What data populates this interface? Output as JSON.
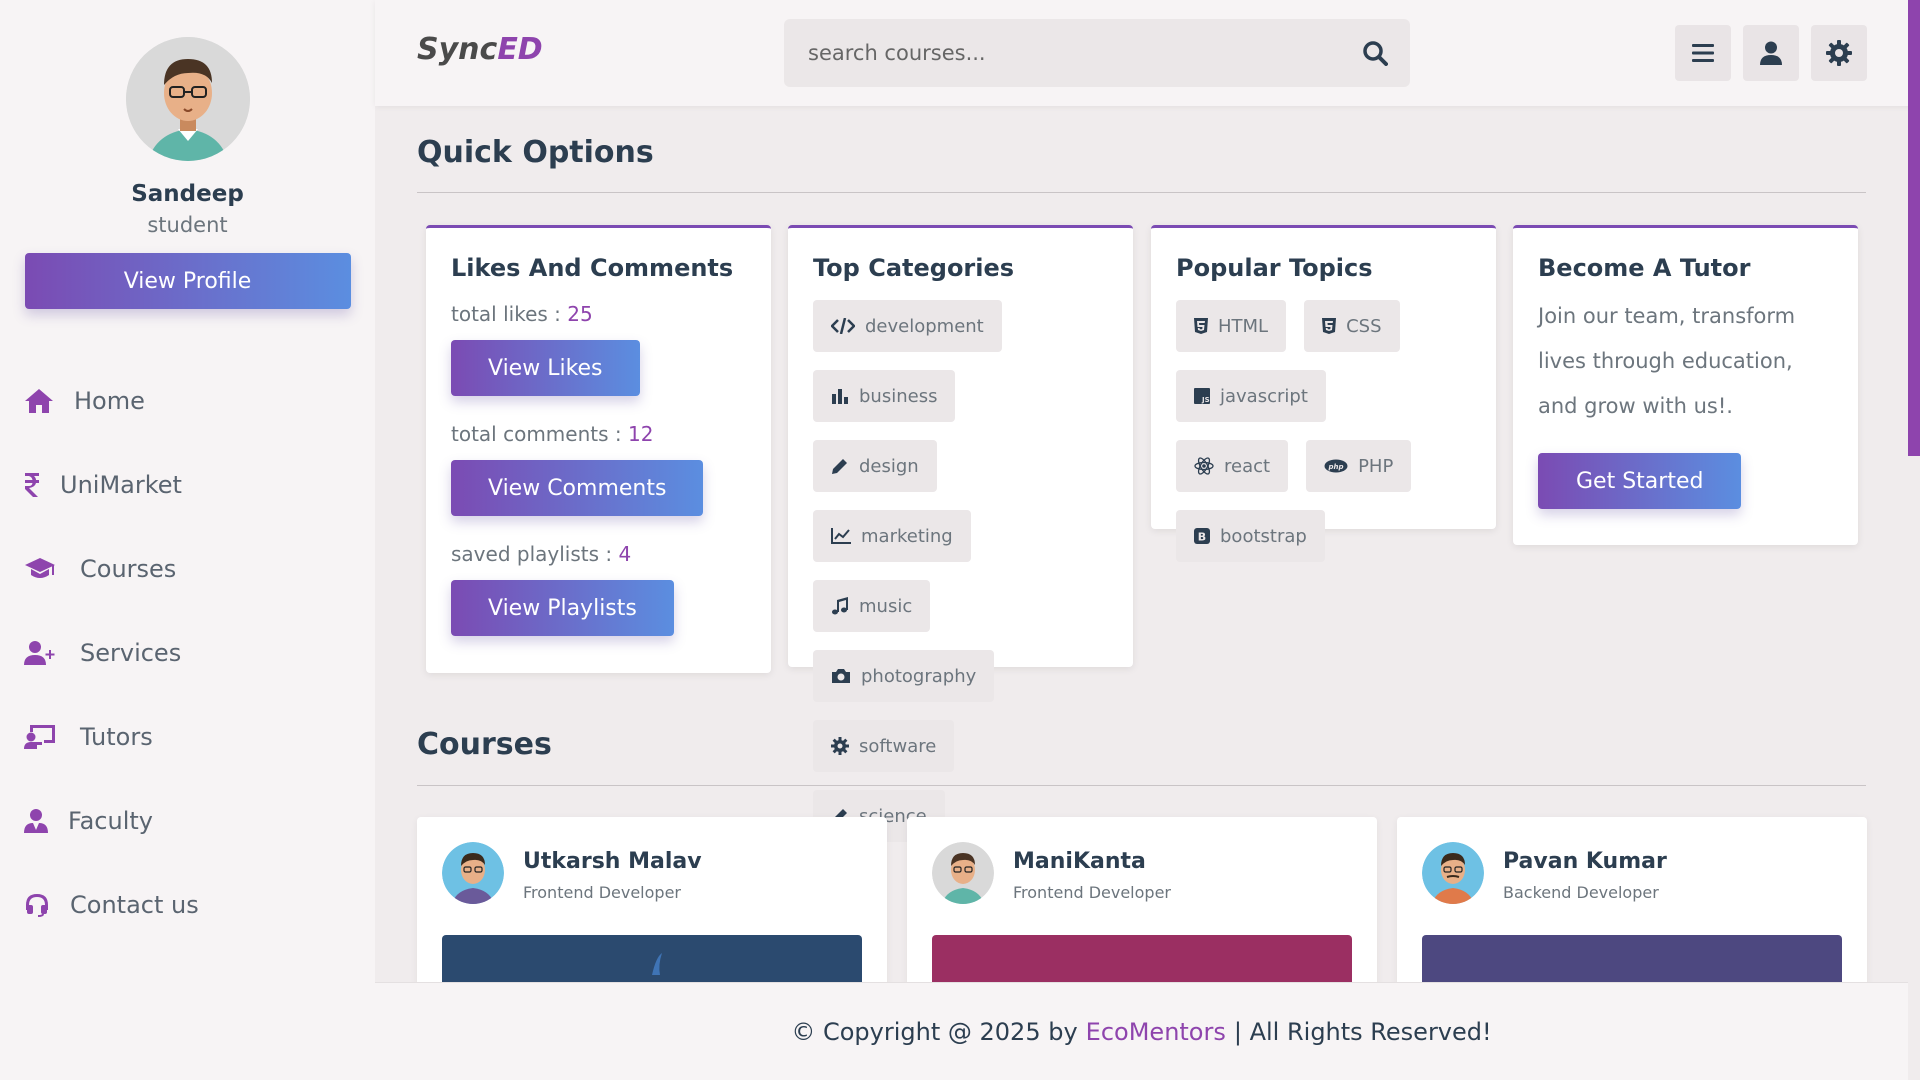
{
  "sidebar": {
    "profile": {
      "name": "Sandeep",
      "role": "student",
      "button_label": "View Profile"
    },
    "nav": [
      {
        "label": "Home",
        "icon": "home-icon"
      },
      {
        "label": "UniMarket",
        "icon": "rupee-icon"
      },
      {
        "label": "Courses",
        "icon": "graduation-cap-icon"
      },
      {
        "label": "Services",
        "icon": "user-plus-icon"
      },
      {
        "label": "Tutors",
        "icon": "chalkboard-teacher-icon"
      },
      {
        "label": "Faculty",
        "icon": "user-tie-icon"
      },
      {
        "label": "Contact us",
        "icon": "headset-icon"
      }
    ]
  },
  "header": {
    "logo_main": "Sync",
    "logo_accent": "ED",
    "search_placeholder": "search courses...",
    "buttons": [
      "menu-icon",
      "user-icon",
      "settings-icon"
    ]
  },
  "quick_options": {
    "title": "Quick Options",
    "likes": {
      "title": "Likes And Comments",
      "likes_label": "total likes : ",
      "likes_value": "25",
      "likes_button": "View Likes",
      "comments_label": "total comments : ",
      "comments_value": "12",
      "comments_button": "View Comments",
      "playlists_label": "saved playlists : ",
      "playlists_value": "4",
      "playlists_button": "View Playlists"
    },
    "categories": {
      "title": "Top Categories",
      "items": [
        "development",
        "business",
        "design",
        "marketing",
        "music",
        "photography",
        "software",
        "science"
      ]
    },
    "topics": {
      "title": "Popular Topics",
      "items": [
        "HTML",
        "CSS",
        "javascript",
        "react",
        "PHP",
        "bootstrap"
      ]
    },
    "tutor": {
      "title": "Become A Tutor",
      "text": "Join our team, transform lives through education, and grow with us!.",
      "button": "Get Started"
    }
  },
  "courses": {
    "title": "Courses",
    "items": [
      {
        "name": "Utkarsh Malav",
        "role": "Frontend Developer",
        "thumb_color": "#2b4a6f"
      },
      {
        "name": "ManiKanta",
        "role": "Frontend Developer",
        "thumb_color": "#9b2f62"
      },
      {
        "name": "Pavan Kumar",
        "role": "Backend Developer",
        "thumb_color": "#4d4880"
      }
    ]
  },
  "footer": {
    "prefix": "© Copyright @ 2025 by",
    "brand": "EcoMentors",
    "suffix": "| All Rights Reserved!"
  },
  "colors": {
    "accent": "#8e44ad",
    "gradient_start": "#7b4bb3",
    "gradient_end": "#5b8ee0"
  }
}
